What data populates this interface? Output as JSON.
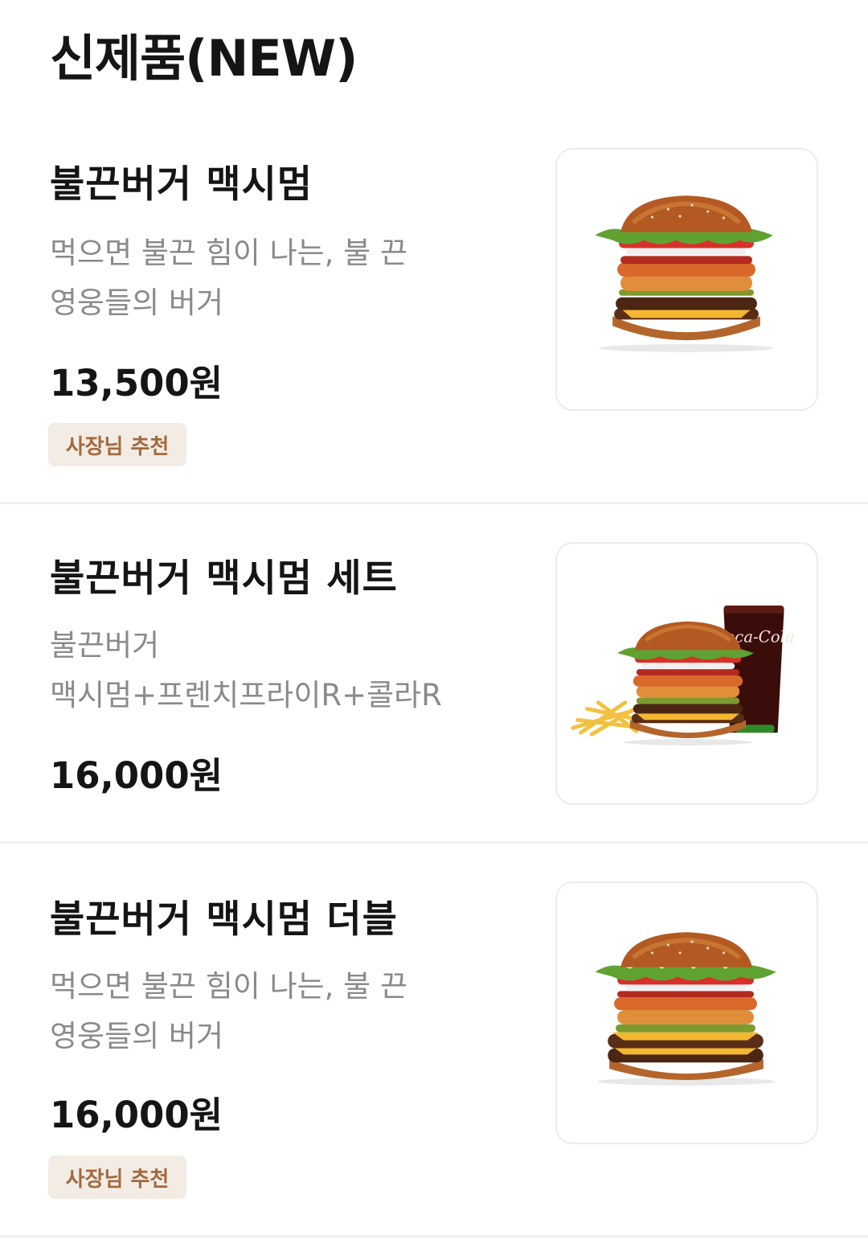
{
  "section": {
    "title": "신제품(NEW)"
  },
  "items": [
    {
      "name": "불끈버거 맥시멈",
      "desc_lines": [
        "먹으면 불끈 힘이 나는, 불 끈",
        "영웅들의 버거"
      ],
      "price": "13,500원",
      "badge": "사장님 추천",
      "image": "burger-single"
    },
    {
      "name": "불끈버거 맥시멈 세트",
      "desc_lines": [
        "불끈버거",
        "맥시멈+프렌치프라이R+콜라R"
      ],
      "price": "16,000원",
      "image": "burger-set",
      "cup_brand": "Coca-Cola"
    },
    {
      "name": "불끈버거 맥시멈 더블",
      "desc_lines": [
        "먹으면 불끈 힘이 나는, 불 끈",
        "영웅들의 버거"
      ],
      "price": "16,000원",
      "badge": "사장님 추천",
      "image": "burger-double"
    }
  ],
  "colors": {
    "badge_bg": "#f3ece4",
    "badge_text": "#a26a3f",
    "desc_text": "#8a8a8a"
  }
}
